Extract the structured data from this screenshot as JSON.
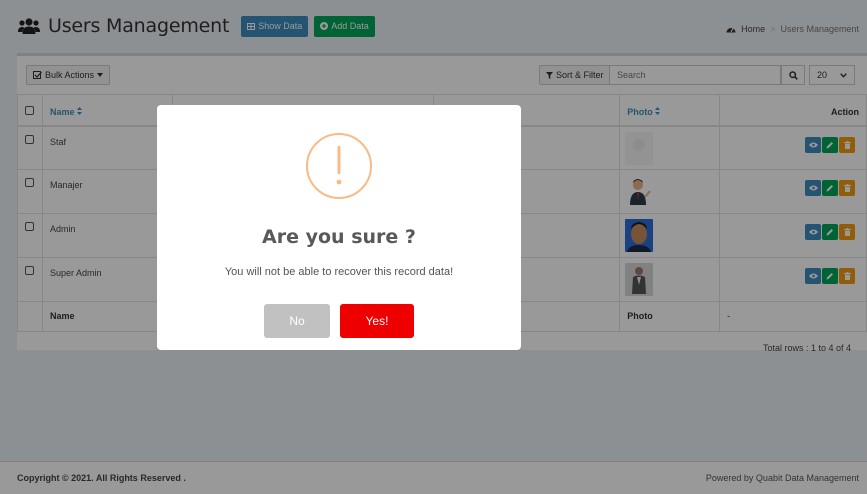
{
  "header": {
    "title": "Users Management",
    "show_data_label": "Show Data",
    "add_data_label": "Add Data"
  },
  "breadcrumb": {
    "home": "Home",
    "current": "Users Management"
  },
  "toolbar": {
    "bulk_actions_label": "Bulk Actions",
    "sort_filter_label": "Sort & Filter",
    "search_placeholder": "Search",
    "per_page": "20"
  },
  "table": {
    "headers": {
      "name": "Name",
      "photo": "Photo",
      "action": "Action"
    },
    "rows": [
      {
        "name": "Staf"
      },
      {
        "name": "Manajer"
      },
      {
        "name": "Admin"
      },
      {
        "name": "Super Admin"
      }
    ],
    "footer": {
      "name": "Name",
      "photo": "Photo",
      "action": "-"
    },
    "total_rows": "Total rows : 1 to 4 of 4"
  },
  "footer": {
    "copyright": "Copyright © 2021. All Rights Reserved .",
    "powered": "Powered by Quabit Data Management"
  },
  "modal": {
    "icon": "warning-icon",
    "title": "Are you sure ?",
    "text": "You will not be able to recover this record data!",
    "no_label": "No",
    "yes_label": "Yes!"
  },
  "colors": {
    "primary": "#3c8dbc",
    "success": "#00a65a",
    "warning": "#f39c12",
    "danger": "#ee0000",
    "modal_icon": "#f8bb86"
  }
}
